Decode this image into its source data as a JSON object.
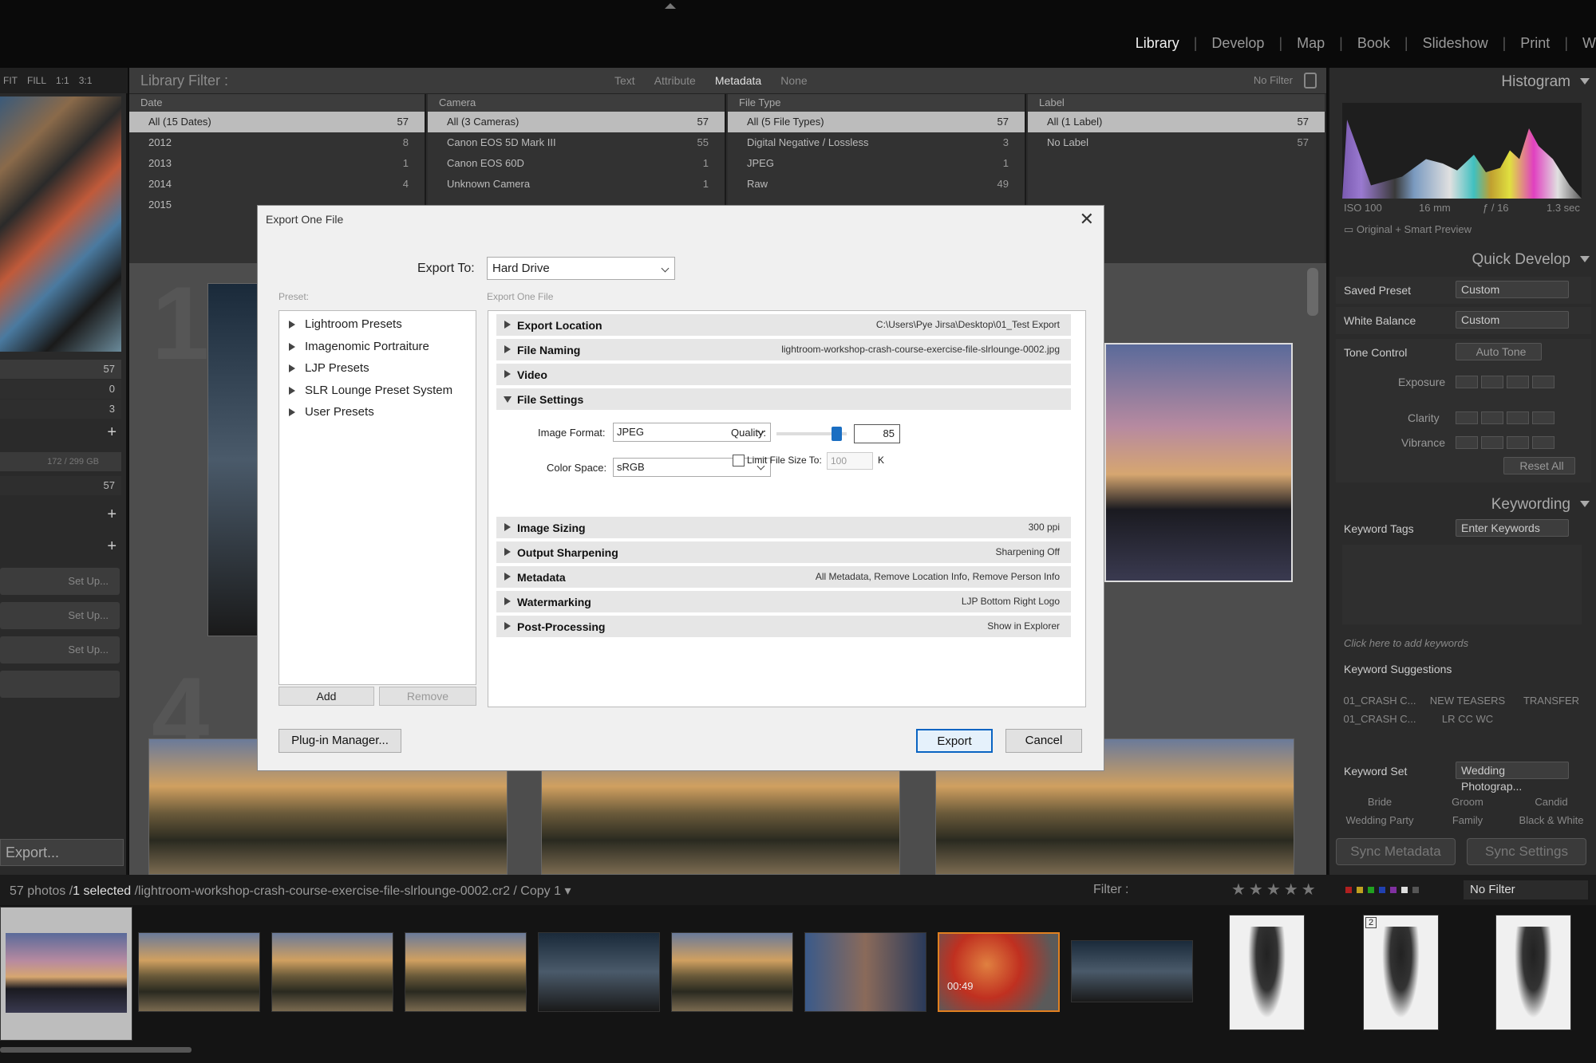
{
  "modules": [
    "Library",
    "Develop",
    "Map",
    "Book",
    "Slideshow",
    "Print",
    "W"
  ],
  "active_module": "Library",
  "left_panel": {
    "nav_options": [
      "FIT",
      "FILL",
      "1:1",
      "3:1"
    ],
    "counts": [
      "57",
      "0",
      "3"
    ],
    "disk": "172 / 299 GB",
    "disk_count": "57",
    "setup_label": "Set Up...",
    "export_label": "Export..."
  },
  "library_filter": {
    "title": "Library Filter :",
    "tabs": [
      "Text",
      "Attribute",
      "Metadata",
      "None"
    ],
    "selected_tab": "Metadata",
    "preset": "No Filter",
    "columns": [
      {
        "header": "Date",
        "rows": [
          [
            "All (15 Dates)",
            "57"
          ],
          [
            "2012",
            "8"
          ],
          [
            "2013",
            "1"
          ],
          [
            "2014",
            "4"
          ],
          [
            "2015",
            ""
          ]
        ]
      },
      {
        "header": "Camera",
        "rows": [
          [
            "All (3 Cameras)",
            "57"
          ],
          [
            "Canon EOS 5D Mark III",
            "55"
          ],
          [
            "Canon EOS 60D",
            "1"
          ],
          [
            "Unknown Camera",
            "1"
          ]
        ]
      },
      {
        "header": "File Type",
        "rows": [
          [
            "All (5 File Types)",
            "57"
          ],
          [
            "Digital Negative / Lossless",
            "3"
          ],
          [
            "JPEG",
            "1"
          ],
          [
            "Raw",
            "49"
          ]
        ]
      },
      {
        "header": "Label",
        "rows": [
          [
            "All (1 Label)",
            "57"
          ],
          [
            "No Label",
            "57"
          ]
        ]
      }
    ]
  },
  "grid_numbers": [
    "1",
    "4"
  ],
  "right_panel": {
    "histogram": "Histogram",
    "exif": [
      "ISO 100",
      "16 mm",
      "ƒ / 16",
      "1.3 sec"
    ],
    "preview_label": "Original + Smart Preview",
    "quick_develop": "Quick Develop",
    "saved_preset_label": "Saved Preset",
    "saved_preset": "Custom",
    "white_balance_label": "White Balance",
    "white_balance": "Custom",
    "tone_control_label": "Tone Control",
    "auto_tone": "Auto Tone",
    "exposure": "Exposure",
    "clarity": "Clarity",
    "vibrance": "Vibrance",
    "reset_all": "Reset All",
    "keywording": "Keywording",
    "keyword_tags_label": "Keyword Tags",
    "keyword_tags": "Enter Keywords",
    "keyword_hint": "Click here to add keywords",
    "keyword_suggestions": "Keyword Suggestions",
    "suggestions": [
      "01_CRASH C...",
      "NEW TEASERS",
      "TRANSFER",
      "01_CRASH C...",
      "LR CC WC",
      ""
    ],
    "keyword_set_label": "Keyword Set",
    "keyword_set": "Wedding Photograp...",
    "set_keywords": [
      "Bride",
      "Groom",
      "Candid",
      "Wedding Party",
      "Family",
      "Black & White"
    ],
    "sync_metadata": "Sync Metadata",
    "sync_settings": "Sync Settings"
  },
  "filmstrip": {
    "count": "57 photos /",
    "selected": "1 selected",
    "path": "/lightroom-workshop-crash-course-exercise-file-slrlounge-0002.cr2 / Copy 1",
    "filter_label": "Filter :",
    "stars": "★★★★★",
    "no_filter": "No Filter",
    "video_time": "00:49",
    "stack_number": "2",
    "label_colors": [
      "#b02020",
      "#c0a020",
      "#20a020",
      "#2040b0",
      "#8030a0",
      "#dddddd",
      "#555555"
    ]
  },
  "dialog": {
    "title": "Export One File",
    "export_to_label": "Export To:",
    "export_to": "Hard Drive",
    "preset_label": "Preset:",
    "settings_label": "Export One File",
    "presets": [
      "Lightroom Presets",
      "Imagenomic Portraiture",
      "LJP Presets",
      "SLR Lounge Preset System",
      "User Presets"
    ],
    "add": "Add",
    "remove": "Remove",
    "sections": [
      {
        "label": "Export Location",
        "value": "C:\\Users\\Pye Jirsa\\Desktop\\01_Test Export"
      },
      {
        "label": "File Naming",
        "value": "lightroom-workshop-crash-course-exercise-file-slrlounge-0002.jpg"
      },
      {
        "label": "Video",
        "value": ""
      },
      {
        "label": "File Settings",
        "value": ""
      },
      {
        "label": "Image Sizing",
        "value": "300 ppi"
      },
      {
        "label": "Output Sharpening",
        "value": "Sharpening Off"
      },
      {
        "label": "Metadata",
        "value": "All Metadata, Remove Location Info, Remove Person Info"
      },
      {
        "label": "Watermarking",
        "value": "LJP Bottom Right Logo"
      },
      {
        "label": "Post-Processing",
        "value": "Show in Explorer"
      }
    ],
    "image_format_label": "Image Format:",
    "image_format": "JPEG",
    "color_space_label": "Color Space:",
    "color_space": "sRGB",
    "quality_label": "Quality:",
    "quality": "85",
    "limit_label": "Limit File Size To:",
    "limit_value": "100",
    "limit_unit": "K",
    "plugin_manager": "Plug-in Manager...",
    "export": "Export",
    "cancel": "Cancel"
  }
}
